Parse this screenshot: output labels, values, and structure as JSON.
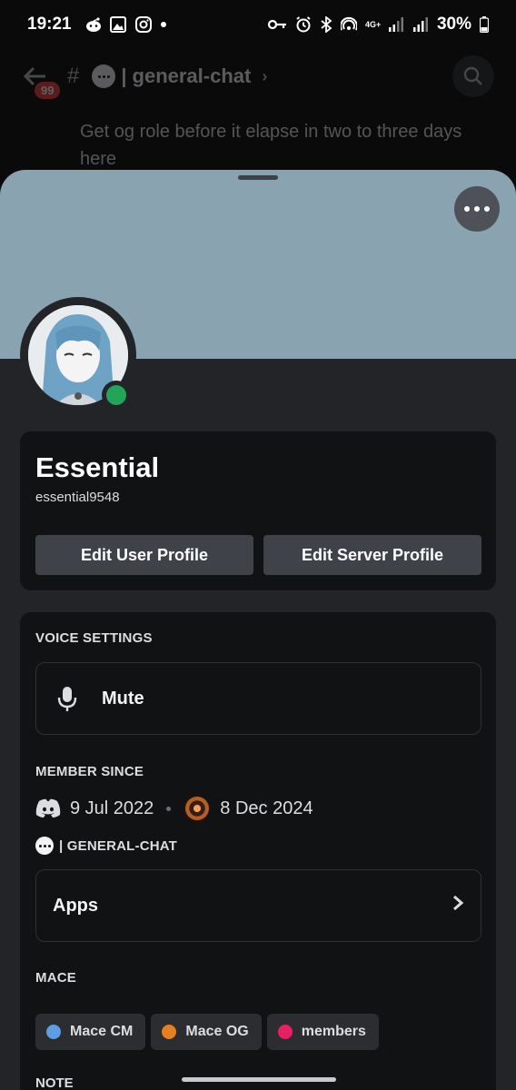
{
  "status_bar": {
    "time": "19:21",
    "network": "4G+",
    "battery": "30%",
    "icons_left": [
      "reddit-icon",
      "gallery-icon",
      "instagram-icon",
      "dot-icon"
    ],
    "icons_right": [
      "vpn-key-icon",
      "alarm-icon",
      "bluetooth-icon",
      "hotspot-icon",
      "signal-icon",
      "signal-icon",
      "battery-icon"
    ]
  },
  "chat": {
    "unread_badge": "99",
    "channel_name": "general-chat",
    "line1": "Get og role before it elapse in two to three days",
    "line2": "here"
  },
  "profile": {
    "display_name": "Essential",
    "username": "essential9548",
    "status": "online",
    "banner_color": "#8aa3b1",
    "buttons": {
      "edit_user": "Edit User Profile",
      "edit_server": "Edit Server Profile"
    }
  },
  "voice": {
    "section_label": "VOICE SETTINGS",
    "mute_label": "Mute"
  },
  "member_since": {
    "section_label": "MEMBER SINCE",
    "discord_date": "9 Jul 2022",
    "server_date": "8 Dec 2024"
  },
  "channel": {
    "section_label": "| GENERAL-CHAT",
    "apps_label": "Apps"
  },
  "server": {
    "section_label": "MACE",
    "roles": [
      {
        "name": "Mace CM",
        "color": "#5b9ee1"
      },
      {
        "name": "Mace OG",
        "color": "#e67e22"
      },
      {
        "name": "members",
        "color": "#e91e63"
      }
    ]
  },
  "note": {
    "section_label": "NOTE"
  }
}
